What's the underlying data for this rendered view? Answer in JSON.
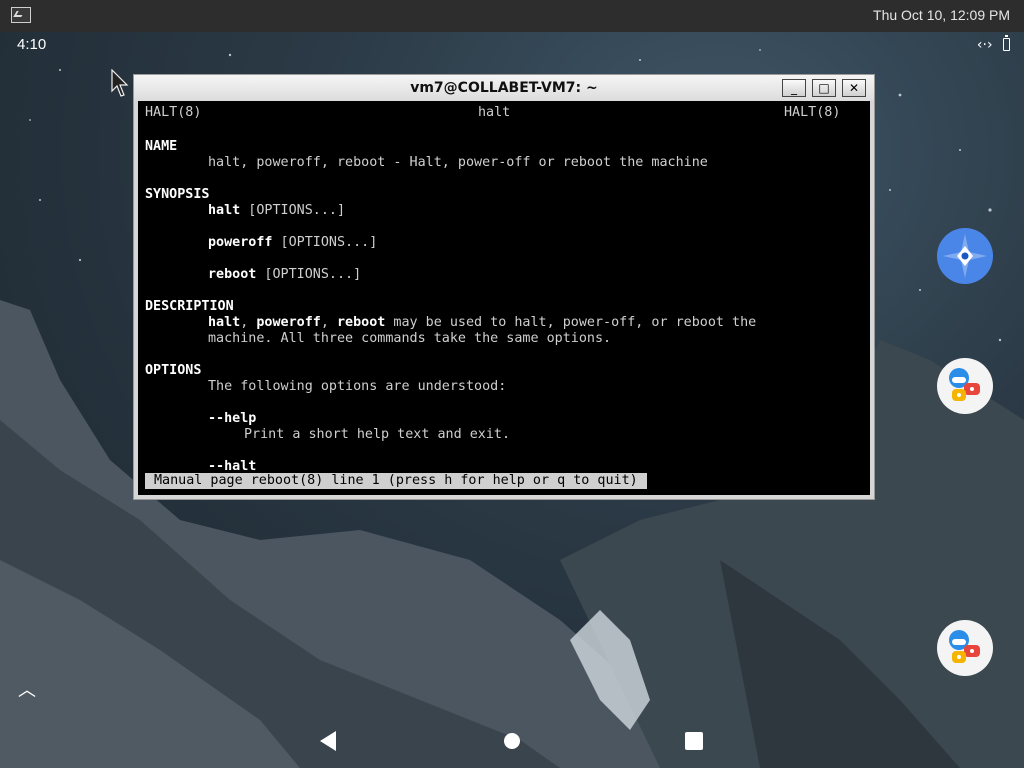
{
  "topbar": {
    "clock": "Thu Oct 10, 12:09 PM",
    "terminal_icon": "terminal-icon"
  },
  "android": {
    "time": "4:10",
    "status_icons": [
      "sync-arrows-icon",
      "battery-icon"
    ]
  },
  "window": {
    "title": "vm7@COLLABET-VM7: ~",
    "buttons": [
      "_",
      "□",
      "✕"
    ]
  },
  "manpage": {
    "header_left": "HALT(8)",
    "header_center": "halt",
    "header_right": "HALT(8)",
    "sections": {
      "name_heading": "NAME",
      "name_text": "halt, poweroff, reboot - Halt, power-off or reboot the machine",
      "synopsis_heading": "SYNOPSIS",
      "synopsis": [
        {
          "cmd": "halt",
          "args": " [OPTIONS...]"
        },
        {
          "cmd": "poweroff",
          "args": " [OPTIONS...]"
        },
        {
          "cmd": "reboot",
          "args": " [OPTIONS...]"
        }
      ],
      "description_heading": "DESCRIPTION",
      "description_cmd1": "halt",
      "description_sep1": ", ",
      "description_cmd2": "poweroff",
      "description_sep2": ", ",
      "description_cmd3": "reboot",
      "description_rest": " may be used to halt, power-off, or reboot the",
      "description_line2": "machine. All three commands take the same options.",
      "options_heading": "OPTIONS",
      "options_intro": "The following options are understood:",
      "option_help": "--help",
      "option_help_text": "Print a short help text and exit.",
      "option_halt": "--halt"
    },
    "status_line": "Manual page reboot(8) line 1 (press h for help or q to quit)"
  },
  "side_buttons": [
    "compass-icon",
    "chat-app-icon",
    "chat-app-icon"
  ],
  "nav": {
    "back": "back-triangle-icon",
    "home": "home-circle-icon",
    "recents": "recents-square-icon",
    "caret": "︿"
  },
  "colors": {
    "terminal_bg": "#000000",
    "terminal_fg": "#cfcfcf",
    "topbar_bg": "#2d2d2d"
  }
}
